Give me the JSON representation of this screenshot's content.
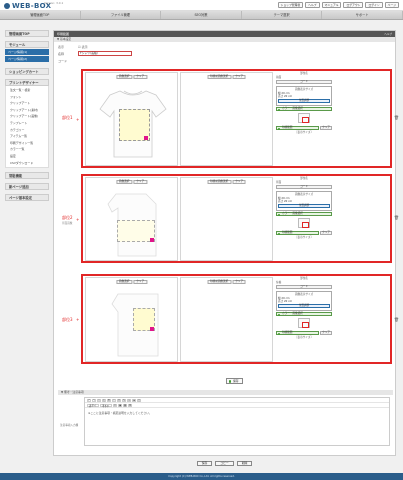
{
  "app": {
    "logo": "WEB-BOX",
    "version": "Version: 3.0.1",
    "top_buttons": [
      "ショップ管理者",
      "ヘルプ",
      "マニュアル",
      "ログアウト",
      "ログイン",
      "ページ"
    ]
  },
  "nav": [
    "管理画面TOP",
    "ファイル管理",
    "SEO対策",
    "テーマ選択",
    "サポート"
  ],
  "sidebar": {
    "home": "管理画面TOP",
    "module": "モジュール",
    "module_items": [
      "ページ情報(1)",
      "ページ情報(2)"
    ],
    "shopping_cart": "ショッピングカート",
    "print_designer": "プリントデザイナー",
    "print_items": [
      "注文一覧・検索",
      "フォント",
      "クリップアート",
      "クリップアート(素材)",
      "クリップアート(画像)",
      "テンプレート",
      "カテゴリー",
      "アイテム一覧",
      "印刷デザイン一覧",
      "カラー一覧",
      "設定",
      "CSVダウンロード"
    ],
    "resident": "常駐機能",
    "new_page": "新ページ追加",
    "page_settings": "ページ基本設定"
  },
  "main": {
    "title": "印刷範囲",
    "title_right": "ヘルプ",
    "subtitle": "▼ 基本設定",
    "row1_label": "表示",
    "row1_value": "表示",
    "row2_label": "名称",
    "row2_value": "Tシャツ(長袖)",
    "row3_label": "コード"
  },
  "blocks": [
    {
      "label": "部位1",
      "sub": ""
    },
    {
      "label": "部位2",
      "sub": "背面画像"
    },
    {
      "label": "部位3",
      "sub": ""
    }
  ],
  "panel_buttons": {
    "select_image": "画像選択",
    "clear": "クリア",
    "select_layer": "印刷前画像選択"
  },
  "right_panel": {
    "name_label": "部位名",
    "name_values": [
      "前面",
      "背面",
      "左袖"
    ],
    "code": "コード",
    "size_caption": "画像表示サイズ",
    "width_label": "幅",
    "width_value": "20",
    "height_label": "高さ",
    "height_value": "20",
    "unit": "cm",
    "position_btn": "位置調整",
    "color_btn": "カラー・画像選択",
    "edit_btn": "印刷範囲",
    "clear_btn": "クリア",
    "footer": "［表示サイズ］"
  },
  "save_button": "保存",
  "notes": {
    "bar": "▼ 備考・注意事項",
    "label": "注意事項入力欄",
    "toolbar_select_1": "スタイル",
    "toolbar_select_2": "フォーマット",
    "text": "※ここに注意事項・補足説明を入力してください。"
  },
  "bottom_buttons": [
    "保存",
    "コピー",
    "削除"
  ],
  "footer": "Copyright (C) WEB-BOX Co.,Ltd. All rights reserved."
}
